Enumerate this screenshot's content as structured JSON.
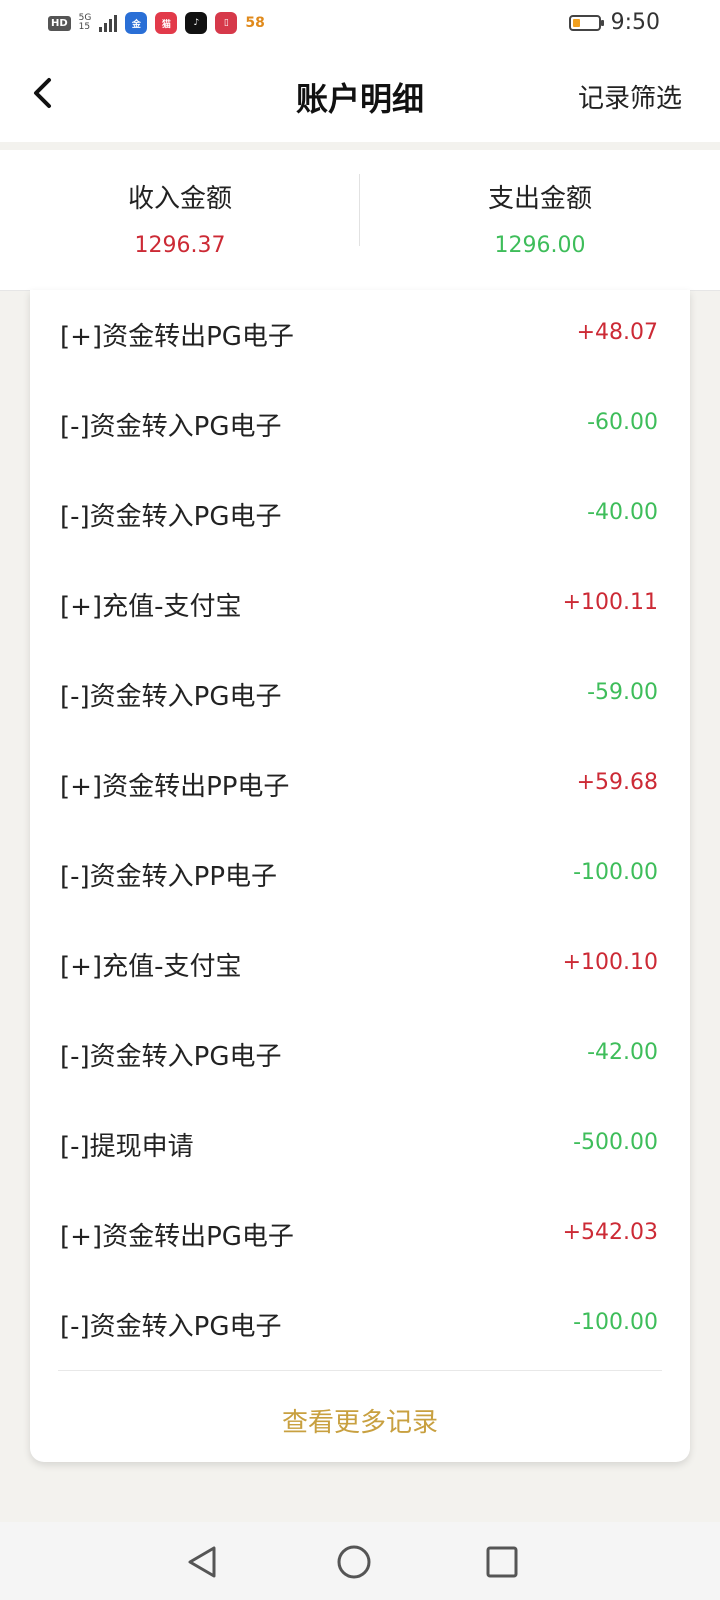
{
  "status_bar": {
    "hd": "HD",
    "net_top": "5G",
    "net_bottom": "15",
    "app_icons": [
      "zhaoshang-jinrong",
      "tmall-icon",
      "douyin-icon",
      "book-icon"
    ],
    "app_58": "58",
    "time": "9:50"
  },
  "header": {
    "back_icon": "chevron-left-icon",
    "title": "账户明细",
    "filter": "记录筛选"
  },
  "summary": {
    "income_label": "收入金额",
    "income_value": "1296.37",
    "expense_label": "支出金额",
    "expense_value": "1296.00"
  },
  "colors": {
    "income": "#cc2a35",
    "expense": "#3ebd5a",
    "link": "#c8a040"
  },
  "records": [
    {
      "name": "[+]资金转出PG电子",
      "amount": "+48.07",
      "type": "in"
    },
    {
      "name": "[-]资金转入PG电子",
      "amount": "-60.00",
      "type": "out"
    },
    {
      "name": "[-]资金转入PG电子",
      "amount": "-40.00",
      "type": "out"
    },
    {
      "name": "[+]充值-支付宝",
      "amount": "+100.11",
      "type": "in"
    },
    {
      "name": "[-]资金转入PG电子",
      "amount": "-59.00",
      "type": "out"
    },
    {
      "name": "[+]资金转出PP电子",
      "amount": "+59.68",
      "type": "in"
    },
    {
      "name": "[-]资金转入PP电子",
      "amount": "-100.00",
      "type": "out"
    },
    {
      "name": "[+]充值-支付宝",
      "amount": "+100.10",
      "type": "in"
    },
    {
      "name": "[-]资金转入PG电子",
      "amount": "-42.00",
      "type": "out"
    },
    {
      "name": "[-]提现申请",
      "amount": "-500.00",
      "type": "out"
    },
    {
      "name": "[+]资金转出PG电子",
      "amount": "+542.03",
      "type": "in"
    },
    {
      "name": "[-]资金转入PG电子",
      "amount": "-100.00",
      "type": "out"
    }
  ],
  "more_link": "查看更多记录",
  "nav": {
    "back_icon": "triangle-back-icon",
    "home_icon": "circle-home-icon",
    "recents_icon": "square-recents-icon"
  }
}
